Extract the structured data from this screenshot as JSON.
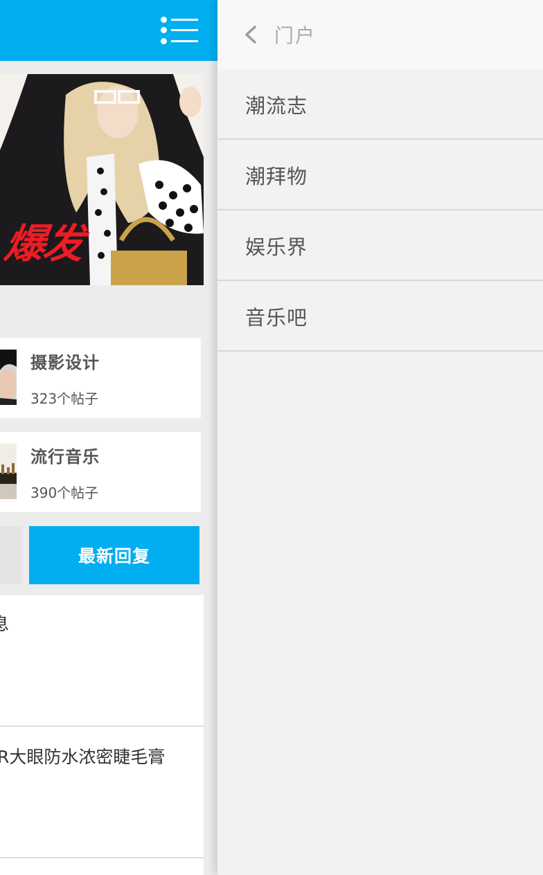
{
  "banner": {
    "overlay_text": "爆发",
    "overlay_color": "#ee1b24"
  },
  "forums": [
    {
      "name": "摄影设计",
      "count": "323个帖子"
    },
    {
      "name": "流行音乐",
      "count": "390个帖子"
    }
  ],
  "tabs": {
    "latest_reply": "最新回复"
  },
  "threads": [
    {
      "title": "息"
    },
    {
      "title": "R大眼防水浓密睫毛膏"
    }
  ],
  "side_menu": {
    "back_icon": "chevron-left-icon",
    "header_title": "门户",
    "items": [
      {
        "label": "潮流志"
      },
      {
        "label": "潮拜物"
      },
      {
        "label": "娱乐界"
      },
      {
        "label": "音乐吧"
      }
    ]
  },
  "colors": {
    "accent": "#01aef0",
    "panel_bg": "#f2f2f2"
  }
}
